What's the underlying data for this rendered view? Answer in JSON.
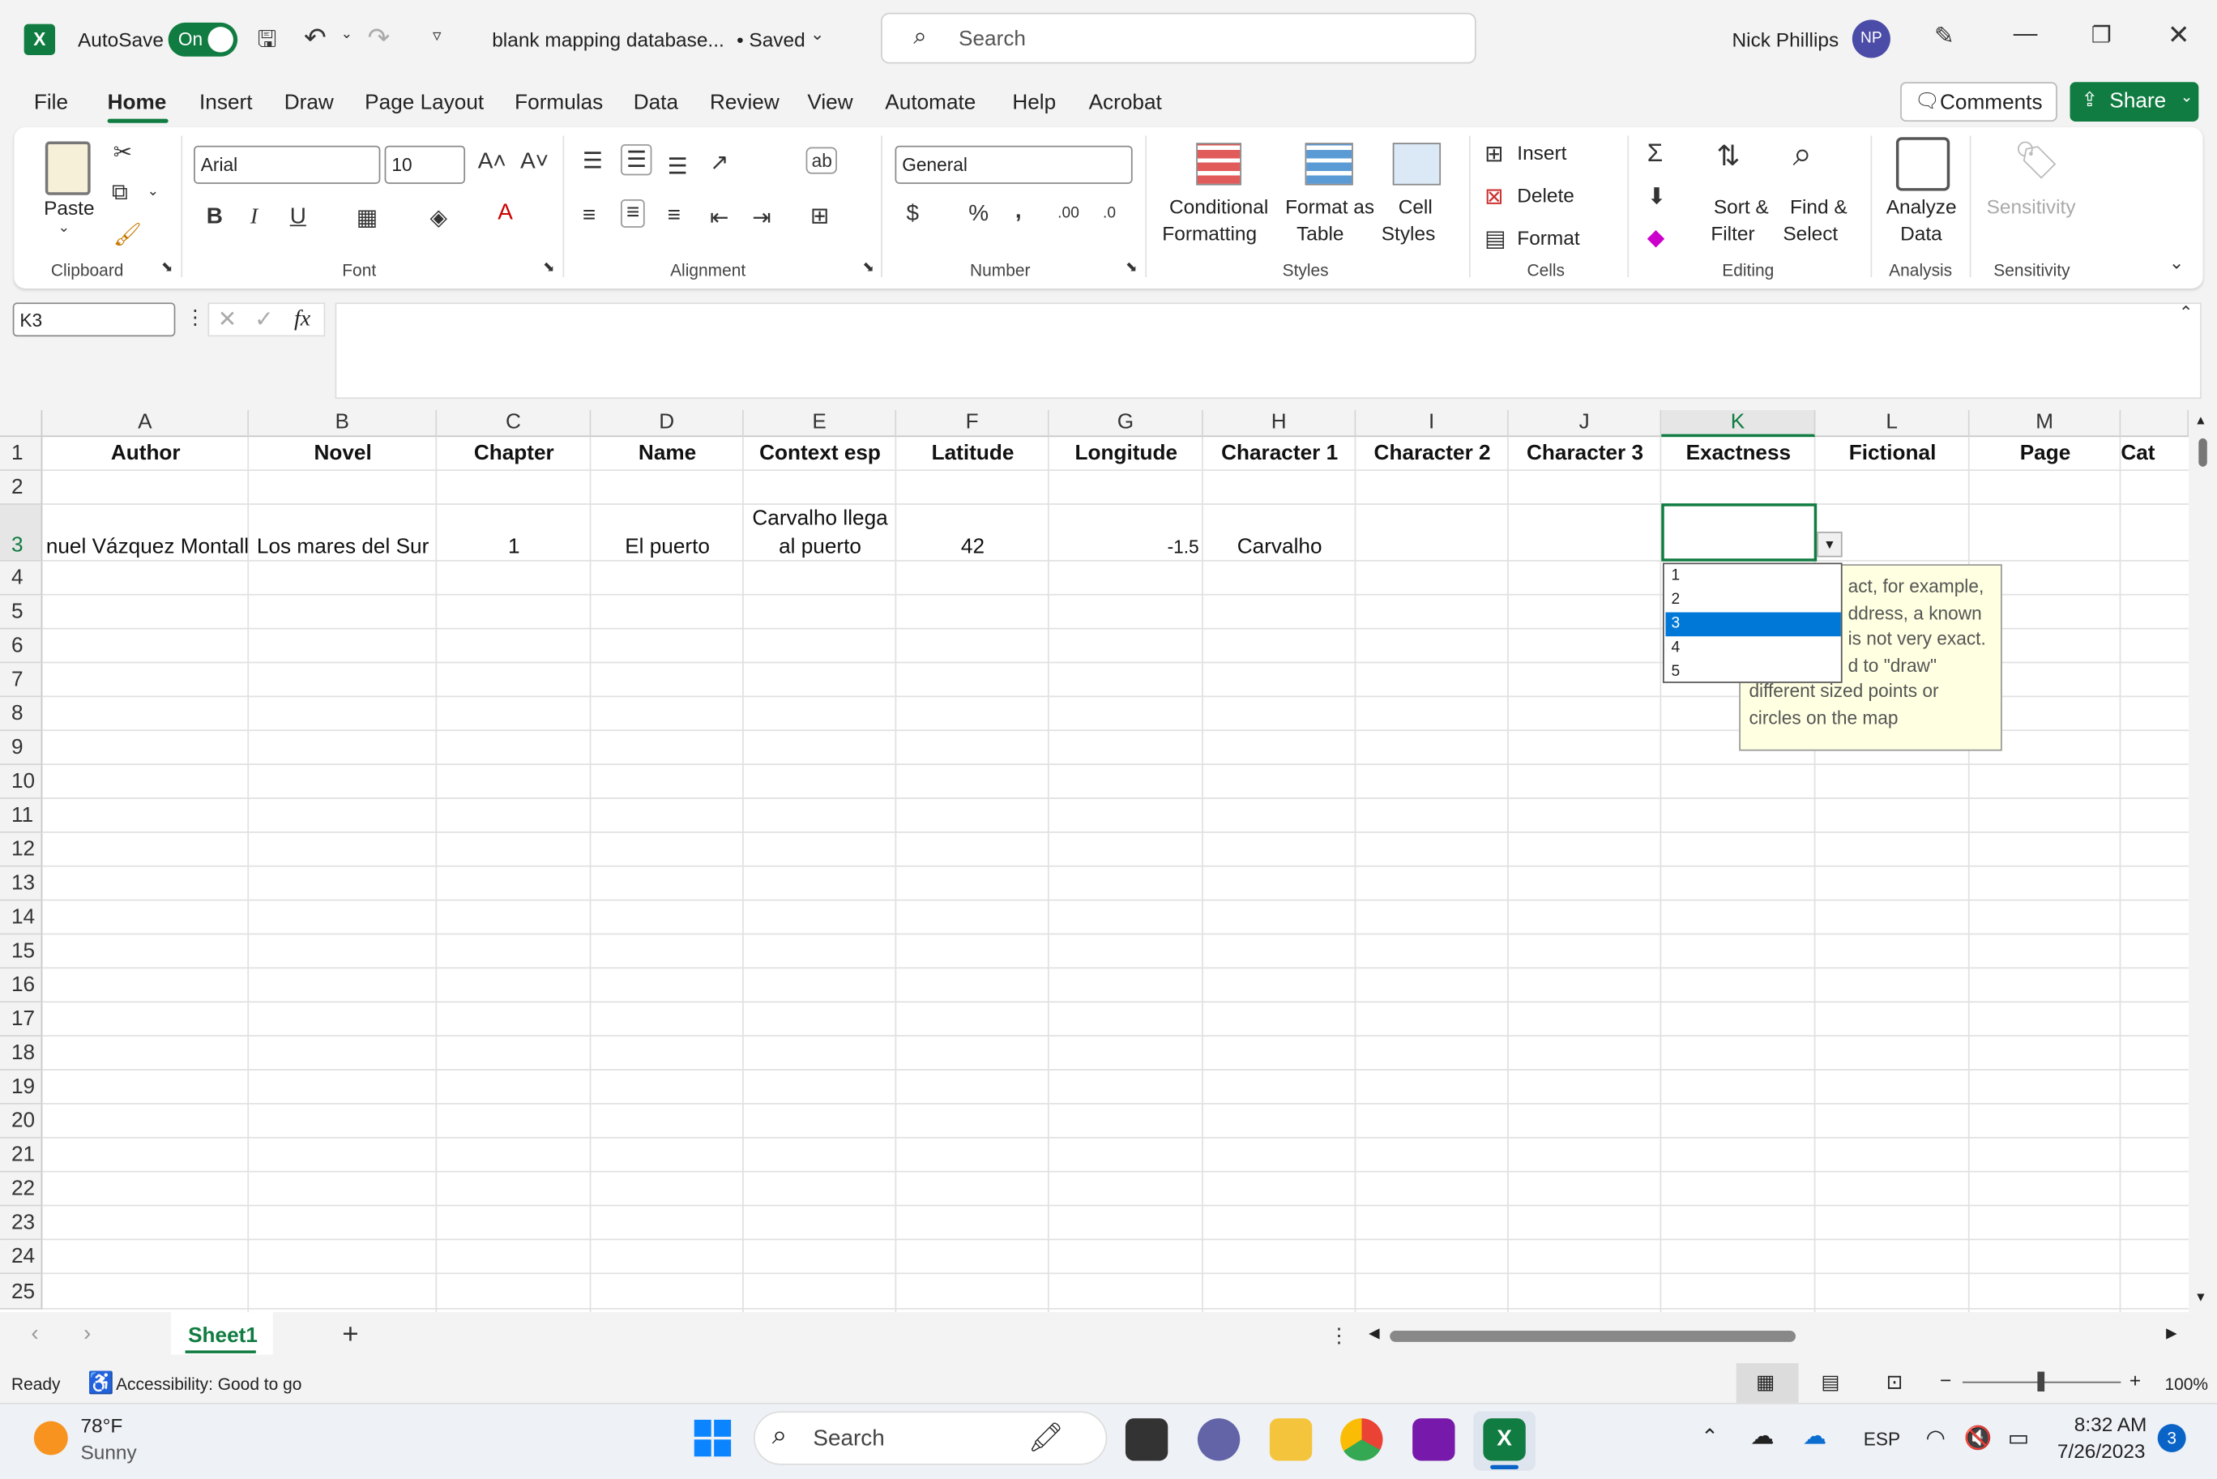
{
  "titlebar": {
    "autosave_label": "AutoSave",
    "autosave_state": "On",
    "filename": "blank mapping database...",
    "saved_status": "• Saved",
    "search_placeholder": "Search",
    "user_name": "Nick Phillips",
    "user_initials": "NP"
  },
  "menu_tabs": [
    "File",
    "Home",
    "Insert",
    "Draw",
    "Page Layout",
    "Formulas",
    "Data",
    "Review",
    "View",
    "Automate",
    "Help",
    "Acrobat"
  ],
  "active_tab": "Home",
  "comments_label": "Comments",
  "share_label": "Share",
  "ribbon": {
    "paste": "Paste",
    "font_name": "Arial",
    "font_size": "10",
    "number_format": "General",
    "conditional_1": "Conditional",
    "conditional_2": "Formatting",
    "format_table_1": "Format as",
    "format_table_2": "Table",
    "cell_styles_1": "Cell",
    "cell_styles_2": "Styles",
    "insert": "Insert",
    "delete": "Delete",
    "format": "Format",
    "sort_1": "Sort &",
    "sort_2": "Filter",
    "find_1": "Find &",
    "find_2": "Select",
    "analyze_1": "Analyze",
    "analyze_2": "Data",
    "sensitivity": "Sensitivity",
    "groups": [
      "Clipboard",
      "Font",
      "Alignment",
      "Number",
      "Styles",
      "Cells",
      "Editing",
      "Analysis",
      "Sensitivity"
    ]
  },
  "formula_bar": {
    "name_box": "K3",
    "fx": "fx",
    "content": ""
  },
  "columns": [
    "A",
    "B",
    "C",
    "D",
    "E",
    "F",
    "G",
    "H",
    "I",
    "J",
    "K",
    "L",
    "M"
  ],
  "column_partial": "Cat",
  "header_row": [
    "Author",
    "Novel",
    "Chapter",
    "Name",
    "Context esp",
    "Latitude",
    "Longitude",
    "Character 1",
    "Character 2",
    "Character 3",
    "Exactness",
    "Fictional",
    "Page"
  ],
  "row3": {
    "author": "nuel Vázquez Montall",
    "novel": "Los mares del Sur",
    "chapter": "1",
    "name": "El puerto",
    "context_1": "Carvalho llega",
    "context_2": "al puerto",
    "latitude": "42",
    "longitude": "-1.5",
    "character1": "Carvalho"
  },
  "row_numbers": [
    "1",
    "2",
    "3",
    "4",
    "5",
    "6",
    "7",
    "8",
    "9",
    "10",
    "11",
    "12",
    "13",
    "14",
    "15",
    "16",
    "17",
    "18",
    "19",
    "20",
    "21",
    "22",
    "23",
    "24",
    "25"
  ],
  "dropdown_options": [
    "1",
    "2",
    "3",
    "4",
    "5"
  ],
  "dropdown_selected": "3",
  "tooltip_lines": [
    "act, for example,",
    "ddress, a known",
    "is not very exact.",
    "d to \"draw\"",
    "different sized points or",
    "circles on the map"
  ],
  "sheet_tab": "Sheet1",
  "status": {
    "ready": "Ready",
    "accessibility": "Accessibility: Good to go",
    "zoom": "100%"
  },
  "taskbar": {
    "weather_temp": "78°F",
    "weather_desc": "Sunny",
    "search": "Search",
    "language": "ESP",
    "time": "8:32 AM",
    "date": "7/26/2023",
    "notifications": "3"
  },
  "colors": {
    "excel_green": "#107c41",
    "selection_blue": "#0078d7",
    "tooltip_bg": "#ffffe1"
  }
}
